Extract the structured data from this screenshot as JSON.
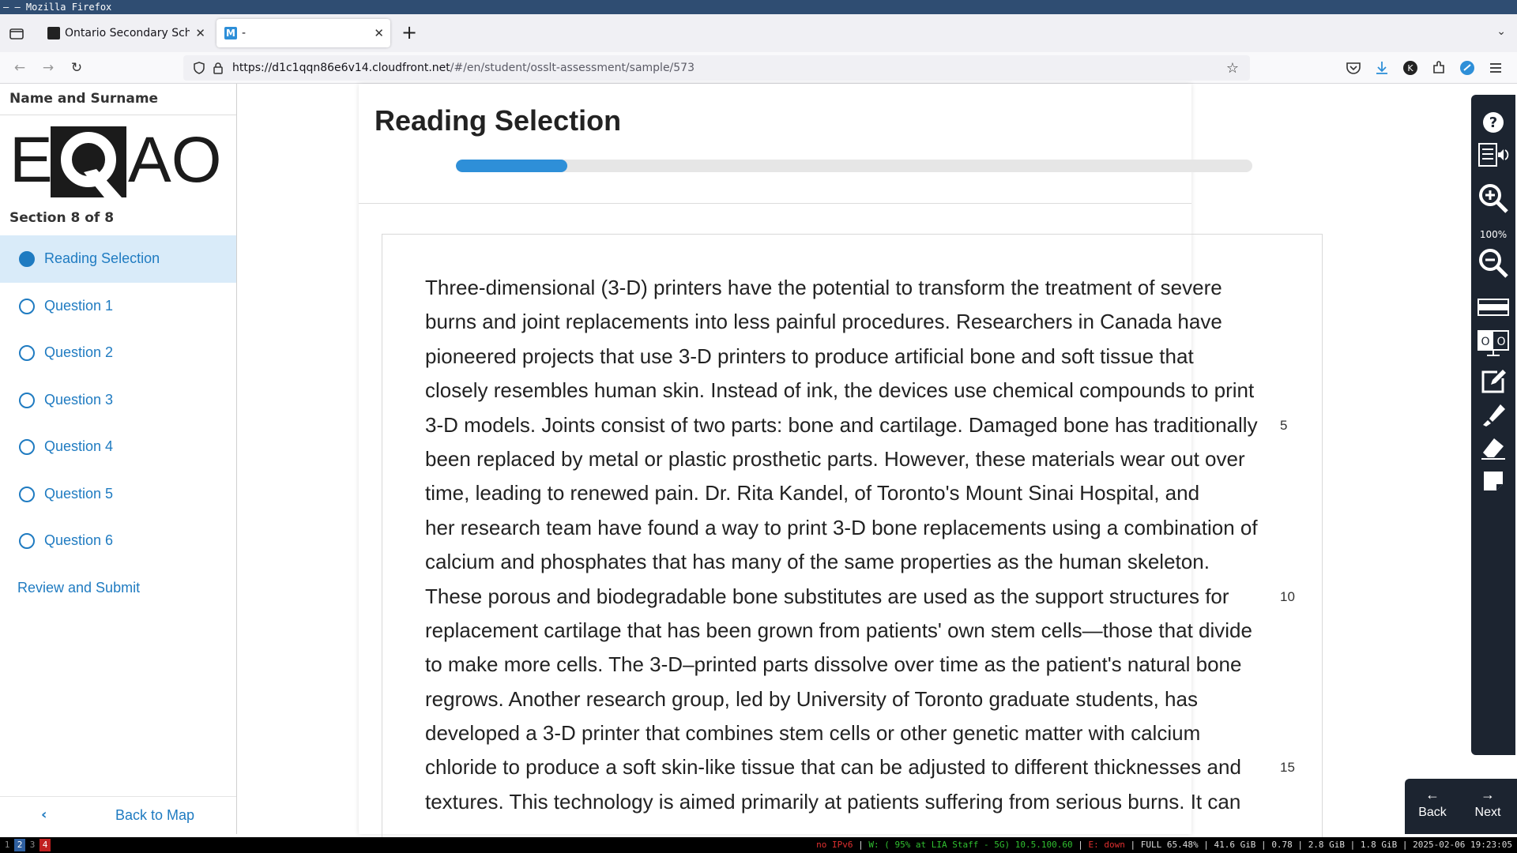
{
  "window": {
    "title": "– – Mozilla Firefox"
  },
  "tabs": [
    {
      "title": "Ontario Secondary School L",
      "favicon": "eqao-favicon"
    },
    {
      "title": "-",
      "favicon": "m-favicon"
    }
  ],
  "navbar": {
    "url_domain": "https://d1c1qqn86e6v14.cloudfront.net",
    "url_path": "/#/en/student/osslt-assessment/sample/573"
  },
  "sidebar": {
    "student_name": "Name and Surname",
    "logo_text": "EQAO",
    "section": "Section 8 of 8",
    "items": [
      {
        "label": "Reading Selection",
        "active": true
      },
      {
        "label": "Question 1",
        "active": false
      },
      {
        "label": "Question 2",
        "active": false
      },
      {
        "label": "Question 3",
        "active": false
      },
      {
        "label": "Question 4",
        "active": false
      },
      {
        "label": "Question 5",
        "active": false
      },
      {
        "label": "Question 6",
        "active": false
      }
    ],
    "review": "Review and Submit",
    "back_to_map": "Back to Map"
  },
  "main": {
    "heading": "Reading Selection",
    "progress_fraction": 0.14,
    "passage_lines": [
      {
        "text": "Three-dimensional (3-D) printers have the potential to transform the treatment of severe",
        "num": ""
      },
      {
        "text": "burns and joint replacements into less painful procedures. Researchers in Canada have",
        "num": ""
      },
      {
        "text": "pioneered projects that use 3-D printers to produce artificial bone and soft tissue that",
        "num": ""
      },
      {
        "text": "closely resembles human skin. Instead of ink, the devices use chemical compounds to print",
        "num": ""
      },
      {
        "text": "3-D models. Joints consist of two parts: bone and cartilage. Damaged bone has traditionally",
        "num": "5"
      },
      {
        "text": "been replaced by metal or plastic prosthetic parts. However, these materials wear out over",
        "num": ""
      },
      {
        "text": "time, leading to renewed pain. Dr. Rita Kandel, of Toronto's Mount Sinai Hospital, and",
        "num": ""
      },
      {
        "text": "her research team have found a way to print 3-D bone replacements using a combination of",
        "num": ""
      },
      {
        "text": "calcium and phosphates that has many of the same properties as the human skeleton.",
        "num": ""
      },
      {
        "text": "These porous and biodegradable bone substitutes are used as the support structures for",
        "num": "10"
      },
      {
        "text": "replacement cartilage that has been grown from patients' own stem cells—those that divide",
        "num": ""
      },
      {
        "text": "to make more cells. The 3-D–printed parts dissolve over time as the patient's natural bone",
        "num": ""
      },
      {
        "text": "regrows. Another research group, led by University of Toronto graduate students, has",
        "num": ""
      },
      {
        "text": "developed a 3-D printer that combines stem cells or other genetic matter with calcium",
        "num": ""
      },
      {
        "text": "chloride to produce a soft skin-like tissue that can be adjusted to different thicknesses and",
        "num": "15"
      },
      {
        "text": "textures. This technology is aimed primarily at patients suffering from serious burns. It can",
        "num": ""
      }
    ]
  },
  "toolbar": {
    "zoom_level": "100%",
    "tools": [
      "help-icon",
      "text-to-speech-icon",
      "zoom-in-icon",
      "zoom-out-icon",
      "line-reader-icon",
      "high-contrast-icon",
      "notepad-icon",
      "highlighter-icon",
      "eraser-icon",
      "sticky-note-icon"
    ],
    "back": "Back",
    "next": "Next"
  },
  "statusbar": {
    "workspaces": [
      "1",
      "2",
      "3",
      "4"
    ],
    "ipv6": "no IPv6",
    "wifi": "W: ( 95% at LIA Staff - 5G) 10.5.100.60",
    "eth": "E: down",
    "battery": "FULL 65.48%",
    "disk": "41.6 GiB",
    "load": "0.78",
    "mem": "2.8 GiB",
    "swap": "1.8 GiB",
    "datetime": "2025-02-06 19:23:05"
  },
  "colors": {
    "accent": "#1f7bc1",
    "progress": "#2e8fd8",
    "toolbar": "#1c2430",
    "titlebar": "#2f4d72"
  }
}
